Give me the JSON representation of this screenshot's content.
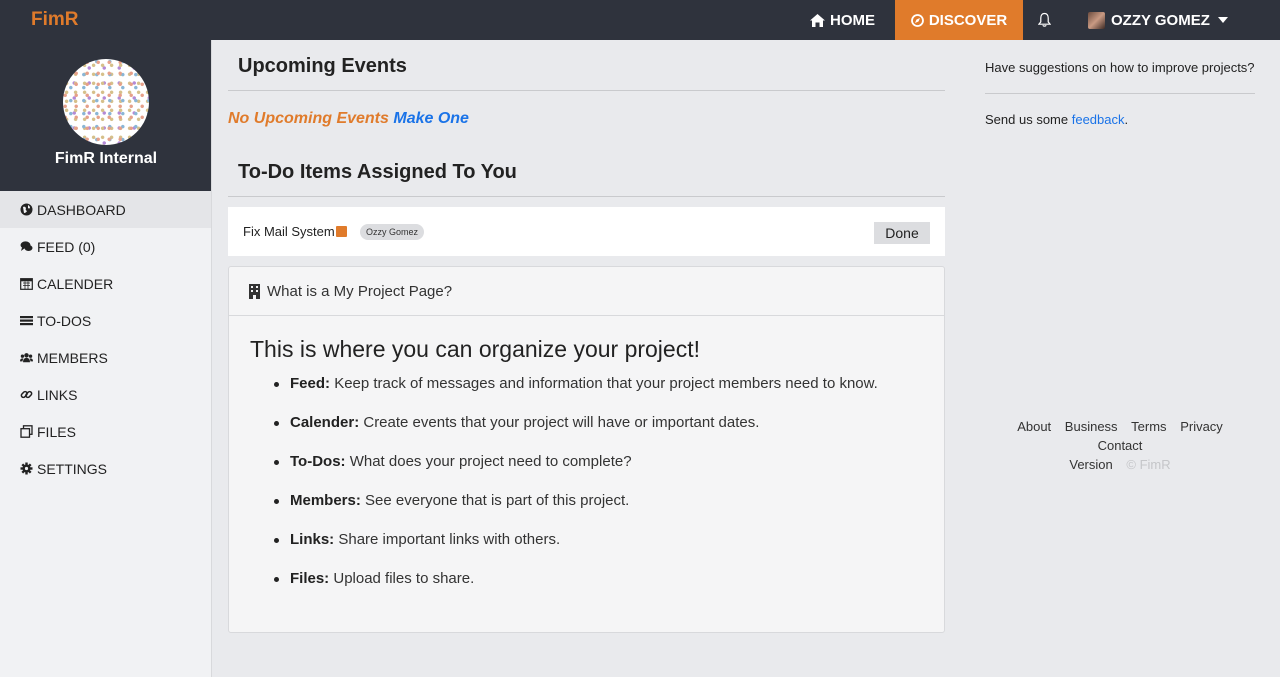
{
  "navbar": {
    "brand": "FimR",
    "home": "HOME",
    "discover": "DISCOVER",
    "user": "OZZY GOMEZ"
  },
  "sidebar": {
    "project_name": "FimR Internal",
    "items": [
      {
        "label": "DASHBOARD",
        "icon": "globe-icon"
      },
      {
        "label": "FEED (0)",
        "icon": "comments-icon"
      },
      {
        "label": "CALENDER",
        "icon": "calendar-icon"
      },
      {
        "label": "TO-DOS",
        "icon": "list-icon"
      },
      {
        "label": "MEMBERS",
        "icon": "users-icon"
      },
      {
        "label": "LINKS",
        "icon": "link-icon"
      },
      {
        "label": "FILES",
        "icon": "files-icon"
      },
      {
        "label": "SETTINGS",
        "icon": "gear-icon"
      }
    ]
  },
  "main": {
    "events_title": "Upcoming Events",
    "no_events": "No Upcoming Events",
    "make_one": "Make One",
    "todo_title": "To-Do Items Assigned To You",
    "todo": {
      "text": "Fix Mail System",
      "assignee": "Ozzy Gomez",
      "done": "Done"
    },
    "card": {
      "header": "What is a My Project Page?",
      "title": "This is where you can organize your project!",
      "items": [
        {
          "term": "Feed:",
          "desc": "Keep track of messages and information that your project members need to know."
        },
        {
          "term": "Calender:",
          "desc": "Create events that your project will have or important dates."
        },
        {
          "term": "To-Dos:",
          "desc": "What does your project need to complete?"
        },
        {
          "term": "Members:",
          "desc": "See everyone that is part of this project."
        },
        {
          "term": "Links:",
          "desc": "Share important links with others."
        },
        {
          "term": "Files:",
          "desc": "Upload files to share."
        }
      ]
    }
  },
  "right": {
    "suggest": "Have suggestions on how to improve projects?",
    "feedback_prefix": "Send us some",
    "feedback_link": "feedback",
    "feedback_suffix": ".",
    "footer_links": [
      "About",
      "Business",
      "Terms",
      "Privacy",
      "Contact"
    ],
    "version": "Version",
    "copyright": "© FimR"
  },
  "colors": {
    "navbar": "#2f333d",
    "accent": "#e07b2b",
    "link": "#1a73e8"
  }
}
